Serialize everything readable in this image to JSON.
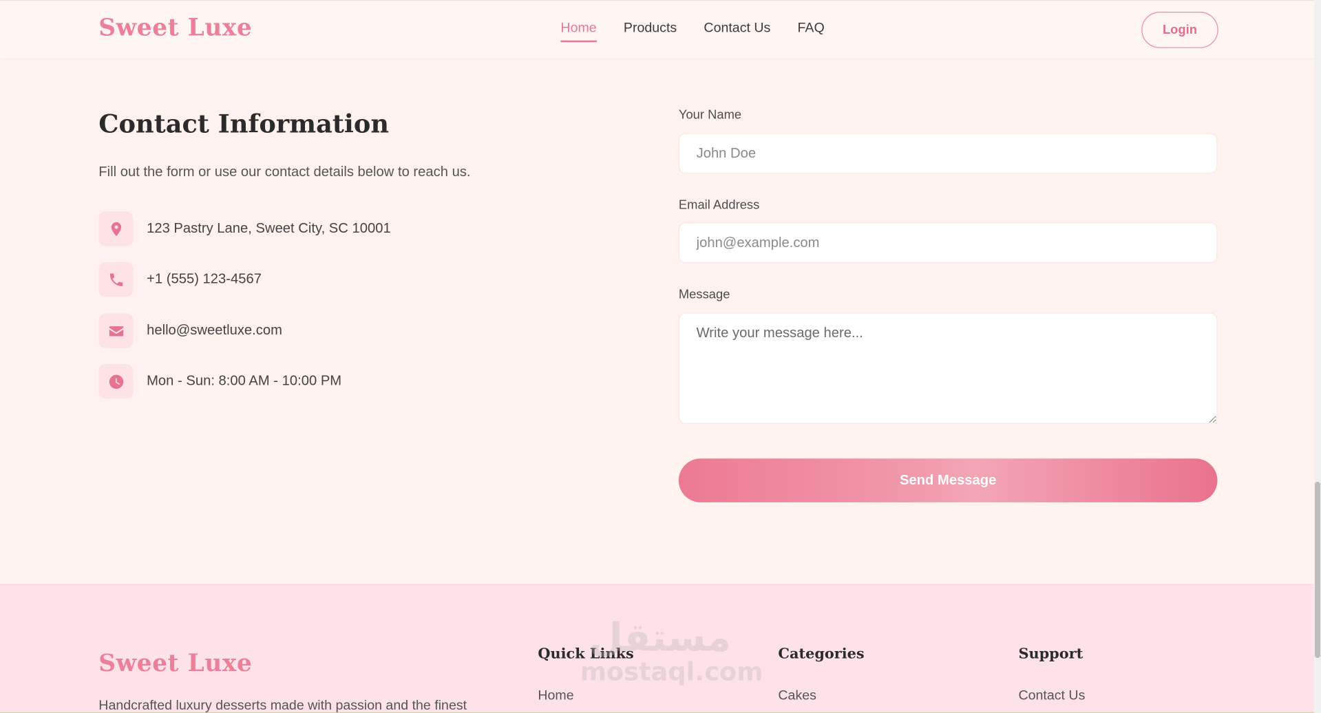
{
  "nav": {
    "brand": "Sweet Luxe",
    "links": [
      "Home",
      "Products",
      "Contact Us",
      "FAQ"
    ],
    "active": "Home",
    "login_label": "Login"
  },
  "contact": {
    "title": "Contact Information",
    "description": "Fill out the form or use our contact details below to reach us.",
    "items": [
      {
        "icon": "map-pin-icon",
        "text": "123 Pastry Lane, Sweet City, SC 10001"
      },
      {
        "icon": "phone-icon",
        "text": "+1 (555) 123-4567"
      },
      {
        "icon": "envelope-icon",
        "text": "hello@sweetluxe.com"
      },
      {
        "icon": "clock-icon",
        "text": "Mon - Sun: 8:00 AM - 10:00 PM"
      }
    ]
  },
  "form": {
    "name_label": "Your Name",
    "name_placeholder": "John Doe",
    "email_label": "Email Address",
    "email_placeholder": "john@example.com",
    "message_label": "Message",
    "message_placeholder": "Write your message here...",
    "submit_label": "Send Message"
  },
  "footer": {
    "brand": "Sweet Luxe",
    "description": "Handcrafted luxury desserts made with passion and the finest",
    "columns": [
      {
        "title": "Quick Links",
        "first_link": "Home"
      },
      {
        "title": "Categories",
        "first_link": "Cakes"
      },
      {
        "title": "Support",
        "first_link": "Contact Us"
      }
    ]
  },
  "watermark": {
    "arabic": "مستقل",
    "latin": "mostaql.com"
  },
  "colors": {
    "accent": "#ec7f99",
    "page_bg": "#fff2ef",
    "footer_bg": "#fde2ea",
    "icon_bg": "#fde3e6"
  }
}
